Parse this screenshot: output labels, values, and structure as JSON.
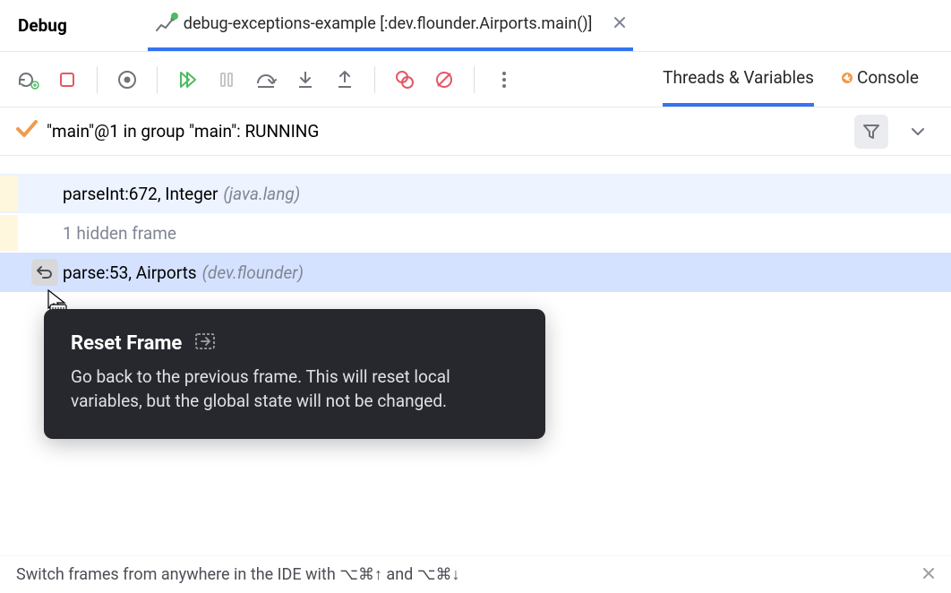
{
  "header": {
    "title": "Debug",
    "tab": {
      "label": "debug-exceptions-example [:dev.flounder.Airports.main()]",
      "close_icon": "close"
    }
  },
  "toolbar": {
    "tabs": {
      "threads": "Threads & Variables",
      "console": "Console"
    }
  },
  "thread": {
    "label": "\"main\"@1 in group \"main\": RUNNING"
  },
  "frames": [
    {
      "method": "parseInt:672, Integer",
      "pkg": "(java.lang)",
      "highlight": true
    },
    {
      "method": "1 hidden frame",
      "pkg": "",
      "dim": true
    },
    {
      "method": "parse:53, Airports",
      "pkg": "(dev.flounder)",
      "selected": true,
      "reset": true
    }
  ],
  "tooltip": {
    "title": "Reset Frame",
    "body": "Go back to the previous frame. This will reset local variables, but the global state will not be changed."
  },
  "hint": {
    "text": "Switch frames from anywhere in the IDE with ⌥⌘↑ and ⌥⌘↓"
  }
}
